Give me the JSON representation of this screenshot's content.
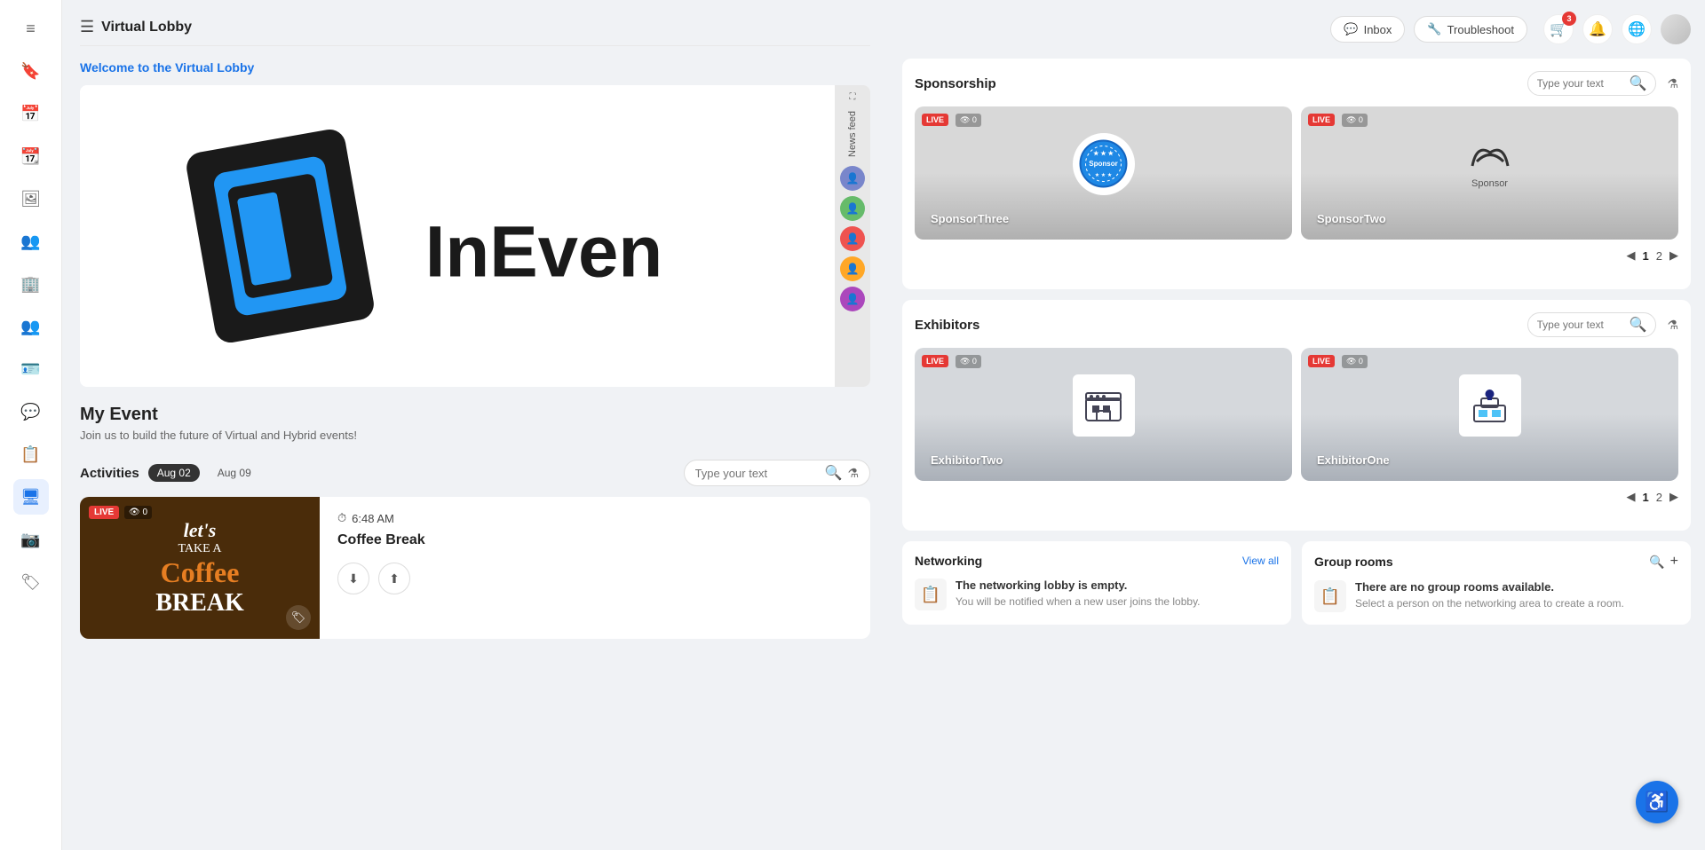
{
  "app": {
    "title": "Virtual Lobby"
  },
  "sidebar": {
    "icons": [
      {
        "name": "menu-icon",
        "symbol": "≡"
      },
      {
        "name": "bookmark-icon",
        "symbol": "🔖"
      },
      {
        "name": "calendar-icon",
        "symbol": "📅"
      },
      {
        "name": "calendar2-icon",
        "symbol": "📆"
      },
      {
        "name": "image-icon",
        "symbol": "🖼"
      },
      {
        "name": "people-icon",
        "symbol": "👥"
      },
      {
        "name": "building-icon",
        "symbol": "🏢"
      },
      {
        "name": "group-icon",
        "symbol": "👥"
      },
      {
        "name": "id-card-icon",
        "symbol": "🪪"
      },
      {
        "name": "chat-icon",
        "symbol": "💬"
      },
      {
        "name": "list-icon",
        "symbol": "📋"
      },
      {
        "name": "monitor-icon",
        "symbol": "🖥"
      },
      {
        "name": "photo-icon",
        "symbol": "📷"
      },
      {
        "name": "tag-icon",
        "symbol": "🏷"
      }
    ]
  },
  "header": {
    "inbox_label": "Inbox",
    "troubleshoot_label": "Troubleshoot",
    "notifications_count": "3"
  },
  "lobby": {
    "welcome": "Welcome to the Virtual Lobby",
    "event_name": "My Event",
    "event_desc": "Join us to build the future of Virtual and Hybrid events!",
    "news_feed_label": "News feed"
  },
  "activities": {
    "title": "Activities",
    "date1": "Aug 02",
    "date2": "Aug 09",
    "search_placeholder": "Type your text",
    "items": [
      {
        "time": "6:48 AM",
        "name": "Coffee Break",
        "thumbnail_text1": "let's",
        "thumbnail_text2": "TAKE A",
        "thumbnail_text3": "Coffee",
        "thumbnail_text4": "BREAK",
        "live": true,
        "viewers": "0"
      }
    ]
  },
  "sponsorship": {
    "title": "Sponsorship",
    "search_placeholder": "Type your text",
    "cards": [
      {
        "name": "SponsorThree",
        "live": true,
        "viewers": "0"
      },
      {
        "name": "SponsorTwo",
        "live": true,
        "viewers": "0"
      }
    ],
    "pagination": {
      "current": 1,
      "total": 2
    }
  },
  "exhibitors": {
    "title": "Exhibitors",
    "search_placeholder": "Type your text",
    "cards": [
      {
        "name": "ExhibitorTwo",
        "live": true,
        "viewers": "0"
      },
      {
        "name": "ExhibitorOne",
        "live": true,
        "viewers": "0"
      }
    ],
    "pagination": {
      "current": 1,
      "total": 2
    }
  },
  "networking": {
    "title": "Networking",
    "view_all": "View all",
    "empty_title": "The networking lobby is empty.",
    "empty_desc": "You will be notified when a new user joins the lobby."
  },
  "group_rooms": {
    "title": "Group rooms",
    "empty_title": "There are no group rooms available.",
    "empty_desc": "Select a person on the networking area to create a room."
  },
  "accessibility": {
    "symbol": "♿"
  }
}
